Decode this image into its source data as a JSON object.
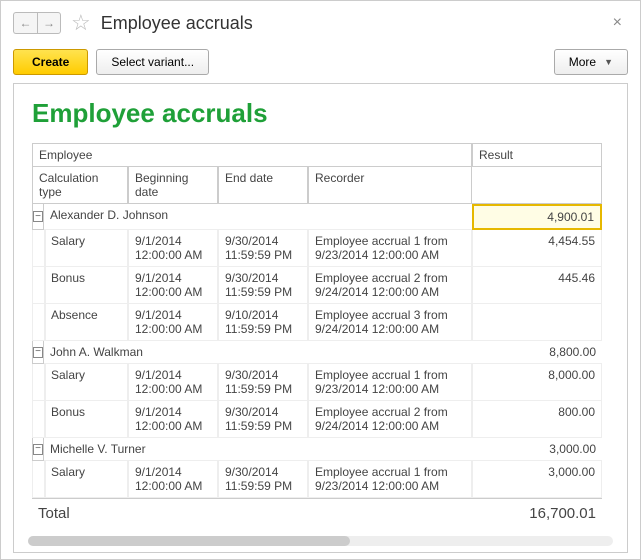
{
  "header": {
    "title": "Employee accruals"
  },
  "toolbar": {
    "create": "Create",
    "select_variant": "Select variant...",
    "more": "More"
  },
  "report": {
    "title": "Employee accruals",
    "columns": {
      "employee": "Employee",
      "result": "Result",
      "calc_type": "Calculation type",
      "begin": "Beginning date",
      "end": "End date",
      "recorder": "Recorder"
    },
    "groups": [
      {
        "name": "Alexander D. Johnson",
        "result": "4,900.01",
        "highlight": true,
        "rows": [
          {
            "type": "Salary",
            "begin": "9/1/2014 12:00:00 AM",
            "end": "9/30/2014 11:59:59 PM",
            "recorder": "Employee accrual 1 from 9/23/2014 12:00:00 AM",
            "result": "4,454.55"
          },
          {
            "type": "Bonus",
            "begin": "9/1/2014 12:00:00 AM",
            "end": "9/30/2014 11:59:59 PM",
            "recorder": "Employee accrual 2 from 9/24/2014 12:00:00 AM",
            "result": "445.46"
          },
          {
            "type": "Absence",
            "begin": "9/1/2014 12:00:00 AM",
            "end": "9/10/2014 11:59:59 PM",
            "recorder": "Employee accrual 3 from 9/24/2014 12:00:00 AM",
            "result": ""
          }
        ]
      },
      {
        "name": "John A. Walkman",
        "result": "8,800.00",
        "rows": [
          {
            "type": "Salary",
            "begin": "9/1/2014 12:00:00 AM",
            "end": "9/30/2014 11:59:59 PM",
            "recorder": "Employee accrual 1 from 9/23/2014 12:00:00 AM",
            "result": "8,000.00"
          },
          {
            "type": "Bonus",
            "begin": "9/1/2014 12:00:00 AM",
            "end": "9/30/2014 11:59:59 PM",
            "recorder": "Employee accrual 2 from 9/24/2014 12:00:00 AM",
            "result": "800.00"
          }
        ]
      },
      {
        "name": "Michelle V. Turner",
        "result": "3,000.00",
        "rows": [
          {
            "type": "Salary",
            "begin": "9/1/2014 12:00:00 AM",
            "end": "9/30/2014 11:59:59 PM",
            "recorder": "Employee accrual 1 from 9/23/2014 12:00:00 AM",
            "result": "3,000.00"
          }
        ]
      }
    ],
    "total_label": "Total",
    "total_value": "16,700.01"
  }
}
